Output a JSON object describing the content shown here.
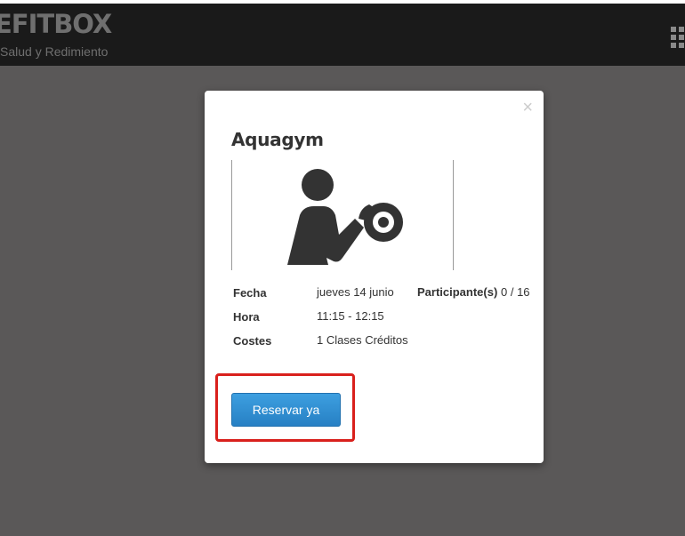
{
  "header": {
    "logo": "EFITBOX",
    "tagline": "Salud y Redimiento"
  },
  "modal": {
    "close_symbol": "×",
    "title": "Aquagym",
    "image_icon": "weightlifter-icon",
    "details": {
      "fecha_label": "Fecha",
      "fecha_value": "jueves 14 junio",
      "hora_label": "Hora",
      "hora_value": "11:15 - 12:15",
      "costes_label": "Costes",
      "costes_value": "1 Clases Créditos",
      "participantes_label": "Participante(s)",
      "participantes_value": "0 / 16"
    },
    "reserve_button_label": "Reservar ya"
  },
  "colors": {
    "overlay": "#5a5858",
    "header": "#1a1a1a",
    "button": "#2f8fd6",
    "highlight": "#d9201c"
  }
}
